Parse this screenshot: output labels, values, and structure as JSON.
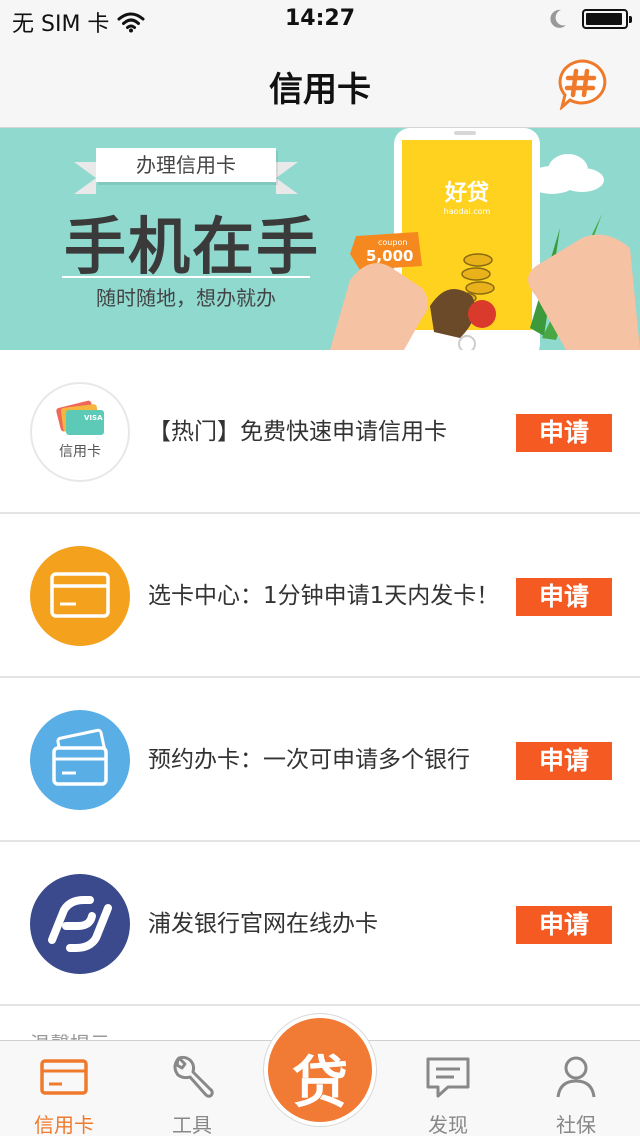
{
  "status_bar": {
    "carrier": "无 SIM 卡",
    "time": "14:27"
  },
  "nav": {
    "title": "信用卡"
  },
  "banner": {
    "tag": "办理信用卡",
    "headline": "手机在手",
    "subline": "随时随地，想办就办",
    "app_logo": "好贷",
    "app_domain": "haodai.com",
    "coupon_label": "coupon",
    "coupon_value": "5,000"
  },
  "list": [
    {
      "icon": "credit-card-logo-icon",
      "icon_caption": "信用卡",
      "card_label": "VISA",
      "text": "【热门】免费快速申请信用卡",
      "button": "申请"
    },
    {
      "icon": "card-icon",
      "text": "选卡中心：1分钟申请1天内发卡！",
      "button": "申请"
    },
    {
      "icon": "card-stack-icon",
      "text": "预约办卡：一次可申请多个银行",
      "button": "申请"
    },
    {
      "icon": "spdb-logo-icon",
      "text": "浦发银行官网在线办卡",
      "button": "申请"
    }
  ],
  "peek_text": "温馨提示",
  "tab_bar": {
    "tabs": [
      {
        "label": "信用卡",
        "icon": "credit-card-icon",
        "active": true
      },
      {
        "label": "工具",
        "icon": "wrench-icon",
        "active": false
      },
      {
        "label": "发现",
        "icon": "chat-icon",
        "active": false
      },
      {
        "label": "社保",
        "icon": "person-icon",
        "active": false
      }
    ],
    "center_label": "贷"
  },
  "colors": {
    "accent": "#f45a22",
    "tab_active": "#f07a2c",
    "banner_bg": "#8fd9cf",
    "card_orange": "#f4a11d",
    "card_blue": "#5aaee6",
    "spdb_navy": "#3a4a8c"
  }
}
